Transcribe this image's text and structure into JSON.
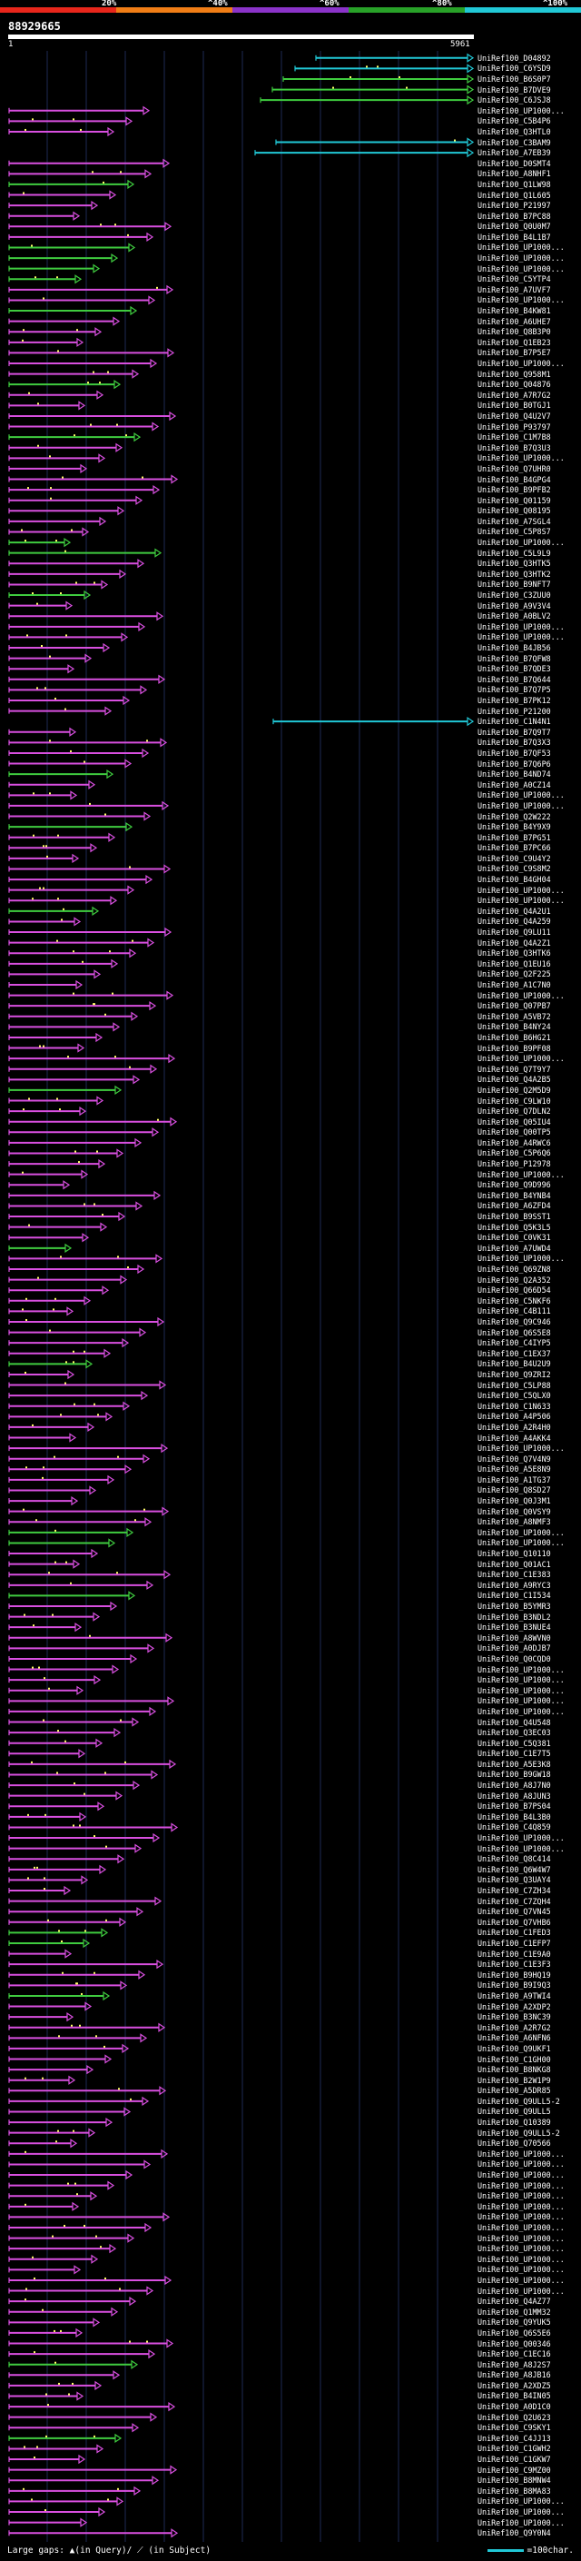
{
  "header": {
    "pct_labels": [
      "20%",
      "^40%",
      "^60%",
      "^80%",
      "^100%"
    ],
    "query_id": "88929665",
    "start_label": "1",
    "end_label": "5961"
  },
  "colors": {
    "band": [
      "#e8261b",
      "#f07d16",
      "#8b33c9",
      "#28a128",
      "#21c8d6"
    ],
    "hit_magenta": "#d94fe0",
    "hit_green": "#3fcc3f",
    "hit_cyan": "#21c8d6"
  },
  "hits": [
    {
      "label": "UniRef100_D04892",
      "color": "cyan"
    },
    {
      "label": "UniRef100_C6YSD9",
      "color": "cyan"
    },
    {
      "label": "UniRef100_B6S0P7",
      "color": "green"
    },
    {
      "label": "UniRef100_B7DVE9",
      "color": "green"
    },
    {
      "label": "UniRef100_C6JSJ8",
      "color": "green"
    },
    {
      "label": "UniRef100_UP1000...",
      "color": "magenta"
    },
    {
      "label": "UniRef100_C5B4P6",
      "color": "magenta"
    },
    {
      "label": "UniRef100_Q3HTL0",
      "color": "magenta"
    },
    {
      "label": "UniRef100_C3BAM9",
      "color": "cyan"
    },
    {
      "label": "UniRef100_A7EB39",
      "color": "cyan"
    },
    {
      "label": "UniRef100_D0SMT4",
      "color": "magenta"
    },
    {
      "label": "UniRef100_A8NHF1",
      "color": "magenta"
    },
    {
      "label": "UniRef100_Q1LW98",
      "color": "green"
    },
    {
      "label": "UniRef100_Q1L605",
      "color": "magenta"
    },
    {
      "label": "UniRef100_P21997",
      "color": "magenta"
    },
    {
      "label": "UniRef100_B7PC88",
      "color": "magenta"
    },
    {
      "label": "UniRef100_Q0U0M7",
      "color": "magenta"
    },
    {
      "label": "UniRef100_B4L1B7",
      "color": "magenta"
    },
    {
      "label": "UniRef100_UP1000...",
      "color": "green"
    },
    {
      "label": "UniRef100_UP1000...",
      "color": "green"
    },
    {
      "label": "UniRef100_UP1000...",
      "color": "green"
    },
    {
      "label": "UniRef100_C5YTP4",
      "color": "green"
    },
    {
      "label": "UniRef100_A7UVF7",
      "color": "magenta"
    },
    {
      "label": "UniRef100_UP1000...",
      "color": "magenta"
    },
    {
      "label": "UniRef100_B4KW81",
      "color": "green"
    },
    {
      "label": "UniRef100_A6UHE7",
      "color": "magenta"
    },
    {
      "label": "UniRef100_Q8B3P0",
      "color": "magenta"
    },
    {
      "label": "UniRef100_Q1EB23",
      "color": "magenta"
    },
    {
      "label": "UniRef100_B7P5E7",
      "color": "magenta"
    },
    {
      "label": "UniRef100_UP1000...",
      "color": "magenta"
    },
    {
      "label": "UniRef100_Q958M1",
      "color": "magenta"
    },
    {
      "label": "UniRef100_Q04876",
      "color": "green"
    },
    {
      "label": "UniRef100_A7R7G2",
      "color": "magenta"
    },
    {
      "label": "UniRef100_B0TGJ1",
      "color": "magenta"
    },
    {
      "label": "UniRef100_Q4U2V7",
      "color": "magenta"
    },
    {
      "label": "UniRef100_P93797",
      "color": "magenta"
    },
    {
      "label": "UniRef100_C1M7B8",
      "color": "green"
    },
    {
      "label": "UniRef100_B7Q3U3",
      "color": "magenta"
    },
    {
      "label": "UniRef100_UP1000...",
      "color": "magenta"
    },
    {
      "label": "UniRef100_Q7UHR0",
      "color": "magenta"
    },
    {
      "label": "UniRef100_B4GPG4",
      "color": "magenta"
    },
    {
      "label": "UniRef100_B9PFB2",
      "color": "magenta"
    },
    {
      "label": "UniRef100_Q01159",
      "color": "magenta"
    },
    {
      "label": "UniRef100_Q08195",
      "color": "magenta"
    },
    {
      "label": "UniRef100_A7SGL4",
      "color": "magenta"
    },
    {
      "label": "UniRef100_C5P8S7",
      "color": "magenta"
    },
    {
      "label": "UniRef100_UP1000...",
      "color": "green"
    },
    {
      "label": "UniRef100_C5L9L9",
      "color": "green"
    },
    {
      "label": "UniRef100_Q3HTK5",
      "color": "magenta"
    },
    {
      "label": "UniRef100_Q3HTK2",
      "color": "magenta"
    },
    {
      "label": "UniRef100_B9NFT7",
      "color": "magenta"
    },
    {
      "label": "UniRef100_C3ZUU0",
      "color": "green"
    },
    {
      "label": "UniRef100_A9V3V4",
      "color": "magenta"
    },
    {
      "label": "UniRef100_A0BLV2",
      "color": "magenta"
    },
    {
      "label": "UniRef100_UP1000...",
      "color": "magenta"
    },
    {
      "label": "UniRef100_UP1000...",
      "color": "magenta"
    },
    {
      "label": "UniRef100_B4JB56",
      "color": "magenta"
    },
    {
      "label": "UniRef100_B7QFW8",
      "color": "magenta"
    },
    {
      "label": "UniRef100_B7QDE3",
      "color": "magenta"
    },
    {
      "label": "UniRef100_B7Q644",
      "color": "magenta"
    },
    {
      "label": "UniRef100_B7Q7P5",
      "color": "magenta"
    },
    {
      "label": "UniRef100_B7PK12",
      "color": "magenta"
    },
    {
      "label": "UniRef100_P21200",
      "color": "magenta"
    },
    {
      "label": "UniRef100_C1N4N1",
      "color": "cyan"
    },
    {
      "label": "UniRef100_B7Q9T7",
      "color": "magenta"
    },
    {
      "label": "UniRef100_B7Q3X3",
      "color": "magenta"
    },
    {
      "label": "UniRef100_B7QF53",
      "color": "magenta"
    },
    {
      "label": "UniRef100_B7Q6P6",
      "color": "magenta"
    },
    {
      "label": "UniRef100_B4ND74",
      "color": "green"
    },
    {
      "label": "UniRef100_A0CZ14",
      "color": "magenta"
    },
    {
      "label": "UniRef100_UP1000...",
      "color": "magenta"
    },
    {
      "label": "UniRef100_UP1000...",
      "color": "magenta"
    },
    {
      "label": "UniRef100_Q2W222",
      "color": "magenta"
    },
    {
      "label": "UniRef100_B4Y9X9",
      "color": "green"
    },
    {
      "label": "UniRef100_B7PG51",
      "color": "magenta"
    },
    {
      "label": "UniRef100_B7PC66",
      "color": "magenta"
    },
    {
      "label": "UniRef100_C9U4Y2",
      "color": "magenta"
    },
    {
      "label": "UniRef100_C9S8M2",
      "color": "magenta"
    },
    {
      "label": "UniRef100_B4GH04",
      "color": "magenta"
    },
    {
      "label": "UniRef100_UP1000...",
      "color": "magenta"
    },
    {
      "label": "UniRef100_UP1000...",
      "color": "magenta"
    },
    {
      "label": "UniRef100_Q4A2U1",
      "color": "green"
    },
    {
      "label": "UniRef100_Q4A259",
      "color": "magenta"
    },
    {
      "label": "UniRef100_Q9LU11",
      "color": "magenta"
    },
    {
      "label": "UniRef100_Q4A2Z1",
      "color": "magenta"
    },
    {
      "label": "UniRef100_Q3HTK6",
      "color": "magenta"
    },
    {
      "label": "UniRef100_Q1EU16",
      "color": "magenta"
    },
    {
      "label": "UniRef100_Q2F225",
      "color": "magenta"
    },
    {
      "label": "UniRef100_A1C7N0",
      "color": "magenta"
    },
    {
      "label": "UniRef100_UP1000...",
      "color": "magenta"
    },
    {
      "label": "UniRef100_Q07PB7",
      "color": "magenta"
    },
    {
      "label": "UniRef100_A5VB72",
      "color": "magenta"
    },
    {
      "label": "UniRef100_B4NY24",
      "color": "magenta"
    },
    {
      "label": "UniRef100_B6HG21",
      "color": "magenta"
    },
    {
      "label": "UniRef100_B9PF08",
      "color": "magenta"
    },
    {
      "label": "UniRef100_UP1000...",
      "color": "magenta"
    },
    {
      "label": "UniRef100_Q7T9Y7",
      "color": "magenta"
    },
    {
      "label": "UniRef100_Q4A2B5",
      "color": "magenta"
    },
    {
      "label": "UniRef100_Q2M5D9",
      "color": "green"
    },
    {
      "label": "UniRef100_C9LW10",
      "color": "magenta"
    },
    {
      "label": "UniRef100_Q7DLN2",
      "color": "magenta"
    },
    {
      "label": "UniRef100_Q05IU4",
      "color": "magenta"
    },
    {
      "label": "UniRef100_Q00TP5",
      "color": "magenta"
    },
    {
      "label": "UniRef100_A4RWC6",
      "color": "magenta"
    },
    {
      "label": "UniRef100_C5P6Q6",
      "color": "magenta"
    },
    {
      "label": "UniRef100_P12978",
      "color": "magenta"
    },
    {
      "label": "UniRef100_UP1000...",
      "color": "magenta"
    },
    {
      "label": "UniRef100_Q9D996",
      "color": "magenta"
    },
    {
      "label": "UniRef100_B4YNB4",
      "color": "magenta"
    },
    {
      "label": "UniRef100_A6ZFD4",
      "color": "magenta"
    },
    {
      "label": "UniRef100_B9SST1",
      "color": "magenta"
    },
    {
      "label": "UniRef100_Q5K3L5",
      "color": "magenta"
    },
    {
      "label": "UniRef100_C0VK31",
      "color": "magenta"
    },
    {
      "label": "UniRef100_A7UWD4",
      "color": "green"
    },
    {
      "label": "UniRef100_UP1000...",
      "color": "magenta"
    },
    {
      "label": "UniRef100_Q69ZN8",
      "color": "magenta"
    },
    {
      "label": "UniRef100_Q2A352",
      "color": "magenta"
    },
    {
      "label": "UniRef100_Q66D54",
      "color": "magenta"
    },
    {
      "label": "UniRef100_C5NKF6",
      "color": "magenta"
    },
    {
      "label": "UniRef100_C4B111",
      "color": "magenta"
    },
    {
      "label": "UniRef100_Q9C946",
      "color": "magenta"
    },
    {
      "label": "UniRef100_Q6S5E8",
      "color": "magenta"
    },
    {
      "label": "UniRef100_C4IYP5",
      "color": "magenta"
    },
    {
      "label": "UniRef100_C1EX37",
      "color": "magenta"
    },
    {
      "label": "UniRef100_B4U2U9",
      "color": "green"
    },
    {
      "label": "UniRef100_Q9ZRI2",
      "color": "magenta"
    },
    {
      "label": "UniRef100_C5LP88",
      "color": "magenta"
    },
    {
      "label": "UniRef100_C5QLX0",
      "color": "magenta"
    },
    {
      "label": "UniRef100_C1N633",
      "color": "magenta"
    },
    {
      "label": "UniRef100_A4P506",
      "color": "magenta"
    },
    {
      "label": "UniRef100_A2R4H0",
      "color": "magenta"
    },
    {
      "label": "UniRef100_A4AKK4",
      "color": "magenta"
    },
    {
      "label": "UniRef100_UP1000...",
      "color": "magenta"
    },
    {
      "label": "UniRef100_Q7V4N9",
      "color": "magenta"
    },
    {
      "label": "UniRef100_A5E8N9",
      "color": "magenta"
    },
    {
      "label": "UniRef100_A1TG37",
      "color": "magenta"
    },
    {
      "label": "UniRef100_Q8SD27",
      "color": "magenta"
    },
    {
      "label": "UniRef100_Q0J3M1",
      "color": "magenta"
    },
    {
      "label": "UniRef100_Q0VSY9",
      "color": "magenta"
    },
    {
      "label": "UniRef100_A8NMF3",
      "color": "magenta"
    },
    {
      "label": "UniRef100_UP1000...",
      "color": "green"
    },
    {
      "label": "UniRef100_UP1000...",
      "color": "green"
    },
    {
      "label": "UniRef100_Q10110",
      "color": "magenta"
    },
    {
      "label": "UniRef100_Q01AC1",
      "color": "magenta"
    },
    {
      "label": "UniRef100_C1E383",
      "color": "magenta"
    },
    {
      "label": "UniRef100_A9RYC3",
      "color": "magenta"
    },
    {
      "label": "UniRef100_C1I534",
      "color": "green"
    },
    {
      "label": "UniRef100_B5YMR3",
      "color": "magenta"
    },
    {
      "label": "UniRef100_B3NDL2",
      "color": "magenta"
    },
    {
      "label": "UniRef100_B3NUE4",
      "color": "magenta"
    },
    {
      "label": "UniRef100_A8WVN0",
      "color": "magenta"
    },
    {
      "label": "UniRef100_A0DJB7",
      "color": "magenta"
    },
    {
      "label": "UniRef100_Q0CQD0",
      "color": "magenta"
    },
    {
      "label": "UniRef100_UP1000...",
      "color": "magenta"
    },
    {
      "label": "UniRef100_UP1000...",
      "color": "magenta"
    },
    {
      "label": "UniRef100_UP1000...",
      "color": "magenta"
    },
    {
      "label": "UniRef100_UP1000...",
      "color": "magenta"
    },
    {
      "label": "UniRef100_UP1000...",
      "color": "magenta"
    },
    {
      "label": "UniRef100_Q4U548",
      "color": "magenta"
    },
    {
      "label": "UniRef100_Q3EC03",
      "color": "magenta"
    },
    {
      "label": "UniRef100_C5Q381",
      "color": "magenta"
    },
    {
      "label": "UniRef100_C1E7T5",
      "color": "magenta"
    },
    {
      "label": "UniRef100_A5E3K8",
      "color": "magenta"
    },
    {
      "label": "UniRef100_B9GW18",
      "color": "magenta"
    },
    {
      "label": "UniRef100_A8J7N0",
      "color": "magenta"
    },
    {
      "label": "UniRef100_A8JUN3",
      "color": "magenta"
    },
    {
      "label": "UniRef100_B7PS04",
      "color": "magenta"
    },
    {
      "label": "UniRef100_B4L3B0",
      "color": "magenta"
    },
    {
      "label": "UniRef100_C4Q859",
      "color": "magenta"
    },
    {
      "label": "UniRef100_UP1000...",
      "color": "magenta"
    },
    {
      "label": "UniRef100_UP1000...",
      "color": "magenta"
    },
    {
      "label": "UniRef100_Q8C414",
      "color": "magenta"
    },
    {
      "label": "UniRef100_Q6W4W7",
      "color": "magenta"
    },
    {
      "label": "UniRef100_Q3UAY4",
      "color": "magenta"
    },
    {
      "label": "UniRef100_C7ZH34",
      "color": "magenta"
    },
    {
      "label": "UniRef100_C7ZQH4",
      "color": "magenta"
    },
    {
      "label": "UniRef100_Q7VN45",
      "color": "magenta"
    },
    {
      "label": "UniRef100_Q7VHB6",
      "color": "magenta"
    },
    {
      "label": "UniRef100_C1FED3",
      "color": "green"
    },
    {
      "label": "UniRef100_C1EFP7",
      "color": "green"
    },
    {
      "label": "UniRef100_C1E9A0",
      "color": "magenta"
    },
    {
      "label": "UniRef100_C1E3F3",
      "color": "magenta"
    },
    {
      "label": "UniRef100_B9HQ19",
      "color": "magenta"
    },
    {
      "label": "UniRef100_B9I9Q3",
      "color": "magenta"
    },
    {
      "label": "UniRef100_A9TWI4",
      "color": "green"
    },
    {
      "label": "UniRef100_A2XDP2",
      "color": "magenta"
    },
    {
      "label": "UniRef100_B3NC39",
      "color": "magenta"
    },
    {
      "label": "UniRef100_A2R7G2",
      "color": "magenta"
    },
    {
      "label": "UniRef100_A6NFN6",
      "color": "magenta"
    },
    {
      "label": "UniRef100_Q9UKF1",
      "color": "magenta"
    },
    {
      "label": "UniRef100_C1GH00",
      "color": "magenta"
    },
    {
      "label": "UniRef100_B8NKG8",
      "color": "magenta"
    },
    {
      "label": "UniRef100_B2W1P9",
      "color": "magenta"
    },
    {
      "label": "UniRef100_A5DR85",
      "color": "magenta"
    },
    {
      "label": "UniRef100_Q9ULL5-2",
      "color": "magenta"
    },
    {
      "label": "UniRef100_Q9ULL5",
      "color": "magenta"
    },
    {
      "label": "UniRef100_Q10389",
      "color": "magenta"
    },
    {
      "label": "UniRef100_Q9ULL5-2",
      "color": "magenta"
    },
    {
      "label": "UniRef100_Q70566",
      "color": "magenta"
    },
    {
      "label": "UniRef100_UP1000...",
      "color": "magenta"
    },
    {
      "label": "UniRef100_UP1000...",
      "color": "magenta"
    },
    {
      "label": "UniRef100_UP1000...",
      "color": "magenta"
    },
    {
      "label": "UniRef100_UP1000...",
      "color": "magenta"
    },
    {
      "label": "UniRef100_UP1000...",
      "color": "magenta"
    },
    {
      "label": "UniRef100_UP1000...",
      "color": "magenta"
    },
    {
      "label": "UniRef100_UP1000...",
      "color": "magenta"
    },
    {
      "label": "UniRef100_UP1000...",
      "color": "magenta"
    },
    {
      "label": "UniRef100_UP1000...",
      "color": "magenta"
    },
    {
      "label": "UniRef100_UP1000...",
      "color": "magenta"
    },
    {
      "label": "UniRef100_UP1000...",
      "color": "magenta"
    },
    {
      "label": "UniRef100_UP1000...",
      "color": "magenta"
    },
    {
      "label": "UniRef100_UP1000...",
      "color": "magenta"
    },
    {
      "label": "UniRef100_UP1000...",
      "color": "magenta"
    },
    {
      "label": "UniRef100_Q4AZ77",
      "color": "magenta"
    },
    {
      "label": "UniRef100_Q1MM32",
      "color": "magenta"
    },
    {
      "label": "UniRef100_Q9YUK5",
      "color": "magenta"
    },
    {
      "label": "UniRef100_Q6S5E6",
      "color": "magenta"
    },
    {
      "label": "UniRef100_Q00346",
      "color": "magenta"
    },
    {
      "label": "UniRef100_C1EC16",
      "color": "magenta"
    },
    {
      "label": "UniRef100_A8J2S7",
      "color": "green"
    },
    {
      "label": "UniRef100_A8JB16",
      "color": "magenta"
    },
    {
      "label": "UniRef100_A2XDZ5",
      "color": "magenta"
    },
    {
      "label": "UniRef100_B4IN05",
      "color": "magenta"
    },
    {
      "label": "UniRef100_A0D1C0",
      "color": "magenta"
    },
    {
      "label": "UniRef100_Q2U623",
      "color": "magenta"
    },
    {
      "label": "UniRef100_C9SKY1",
      "color": "magenta"
    },
    {
      "label": "UniRef100_C4JJ13",
      "color": "green"
    },
    {
      "label": "UniRef100_C1GWH2",
      "color": "magenta"
    },
    {
      "label": "UniRef100_C1GKW7",
      "color": "magenta"
    },
    {
      "label": "UniRef100_C9MZ00",
      "color": "magenta"
    },
    {
      "label": "UniRef100_B8MNW4",
      "color": "magenta"
    },
    {
      "label": "UniRef100_B8MA83",
      "color": "magenta"
    },
    {
      "label": "UniRef100_UP1000...",
      "color": "magenta"
    },
    {
      "label": "UniRef100_UP1000...",
      "color": "magenta"
    },
    {
      "label": "UniRef100_UP1000...",
      "color": "magenta"
    },
    {
      "label": "UniRef100_Q9Y0N4",
      "color": "magenta"
    }
  ],
  "legend": {
    "gaps_text": "Large gaps:",
    "query_mark": "▲(in Query)/",
    "subject_mark": "⟋ (in Subject)",
    "scale_text": "=100char."
  }
}
